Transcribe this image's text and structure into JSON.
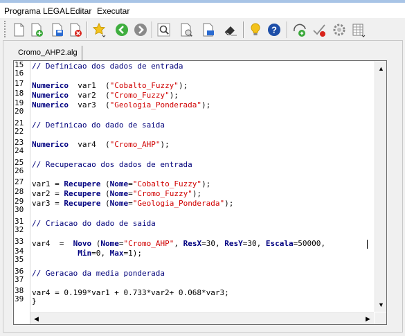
{
  "menu": {
    "items": [
      "Programa LEGAL",
      "Editar",
      "Executar"
    ]
  },
  "toolbar": {
    "buttons": [
      {
        "icon": "new-document-icon"
      },
      {
        "icon": "open-add-icon"
      },
      {
        "icon": "save-icon"
      },
      {
        "icon": "close-red-icon"
      },
      {
        "icon": "star-favorite-icon"
      },
      {
        "icon": "back-arrow-icon"
      },
      {
        "icon": "forward-arrow-icon"
      },
      {
        "icon": "search-icon"
      },
      {
        "icon": "print-preview-icon"
      },
      {
        "icon": "document-export-icon"
      },
      {
        "icon": "eraser-icon"
      },
      {
        "icon": "lightbulb-icon"
      },
      {
        "icon": "help-icon"
      },
      {
        "icon": "run-icon"
      },
      {
        "icon": "checkmark-icon"
      },
      {
        "icon": "gear-icon"
      },
      {
        "icon": "grid-icon"
      }
    ],
    "colors": {
      "accent_blue": "#2a6bd1",
      "help_blue": "#1e4fa8",
      "bulb_yellow": "#f3c21b",
      "close_red": "#d8231b"
    }
  },
  "tab": {
    "label": "Cromo_AHP2.alg"
  },
  "editor": {
    "line_numbers": [
      "15",
      "16",
      "17",
      "18",
      "19",
      "20",
      "21",
      "22",
      "23",
      "24",
      "25",
      "26",
      "27",
      "28",
      "29",
      "30",
      "31",
      "32",
      "33",
      "34",
      "35",
      "36",
      "37",
      "38",
      "39"
    ],
    "code_lines": [
      "// Definicao dos dados de entrada",
      "",
      "Numerico  var1  (\"Cobalto_Fuzzy\");",
      "Numerico  var2  (\"Cromo_Fuzzy\");",
      "Numerico  var3  (\"Geologia_Ponderada\");",
      "",
      "// Definicao do dado de saida",
      "",
      "Numerico  var4  (\"Cromo_AHP\");",
      "",
      "// Recuperacao dos dados de entrada",
      "",
      "var1 = Recupere (Nome=\"Cobalto_Fuzzy\");",
      "var2 = Recupere (Nome=\"Cromo_Fuzzy\");",
      "var3 = Recupere (Nome=\"Geologia_Ponderada\");",
      "",
      "// Criacao do dado de saida",
      "",
      "var4  =  Novo (Nome=\"Cromo_AHP\", ResX=30, ResY=30, Escala=50000,",
      "          Min=0, Max=1);",
      "",
      "// Geracao da media ponderada",
      "",
      "var4 = 0.199*var1 + 0.733*var2+ 0.068*var3;",
      "}"
    ],
    "colors": {
      "keyword": "#000080",
      "string": "#d00000",
      "comment": "#00007a"
    }
  }
}
